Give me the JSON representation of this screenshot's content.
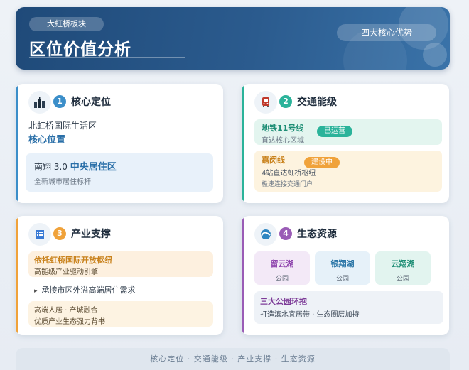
{
  "header": {
    "tag_left": "大虹桥板块",
    "title": "区位价值分析",
    "tag_right": "四大核心优势"
  },
  "cards": [
    {
      "num": "1",
      "title": "核心定位",
      "icon": "city-icon",
      "accent": "#3b8ec9",
      "line1": "北虹桥国际生活区",
      "line2": "核心位置",
      "panel_title_prefix": "南翔 3.0 ",
      "panel_title_strong": "中央居住区",
      "panel_sub": "全新城市居住标杆"
    },
    {
      "num": "2",
      "title": "交通能级",
      "icon": "metro-icon",
      "accent": "#2bb39a",
      "item1_name": "地铁11号线",
      "item1_badge": "已运营",
      "item1_sub": "直达核心区域",
      "item2_name": "嘉闵线",
      "item2_badge": "建设中",
      "item2_sub": "4站直达虹桥枢纽",
      "item2_sub2": "极速连接交通门户"
    },
    {
      "num": "3",
      "title": "产业支撑",
      "icon": "building-icon",
      "accent": "#f0a23a",
      "p1_title": "依托虹桥国际开放枢纽",
      "p1_sub": "高能级产业驱动引擎",
      "mid": "承接市区外溢高端居住需求",
      "p2_line1": "高端人居 · 产城融合",
      "p2_line2": "优质产业生态强力背书"
    },
    {
      "num": "4",
      "title": "生态资源",
      "icon": "wave-icon",
      "accent": "#9a5cb6",
      "lakes": [
        {
          "name": "留云湖",
          "type": "公园"
        },
        {
          "name": "银翔湖",
          "type": "公园"
        },
        {
          "name": "云翔湖",
          "type": "公园"
        }
      ],
      "p_title": "三大公园环抱",
      "p_sub": "打造滨水宜居带 · 生态圈层加持"
    }
  ],
  "footer": "核心定位 · 交通能级 · 产业支撑 · 生态资源"
}
